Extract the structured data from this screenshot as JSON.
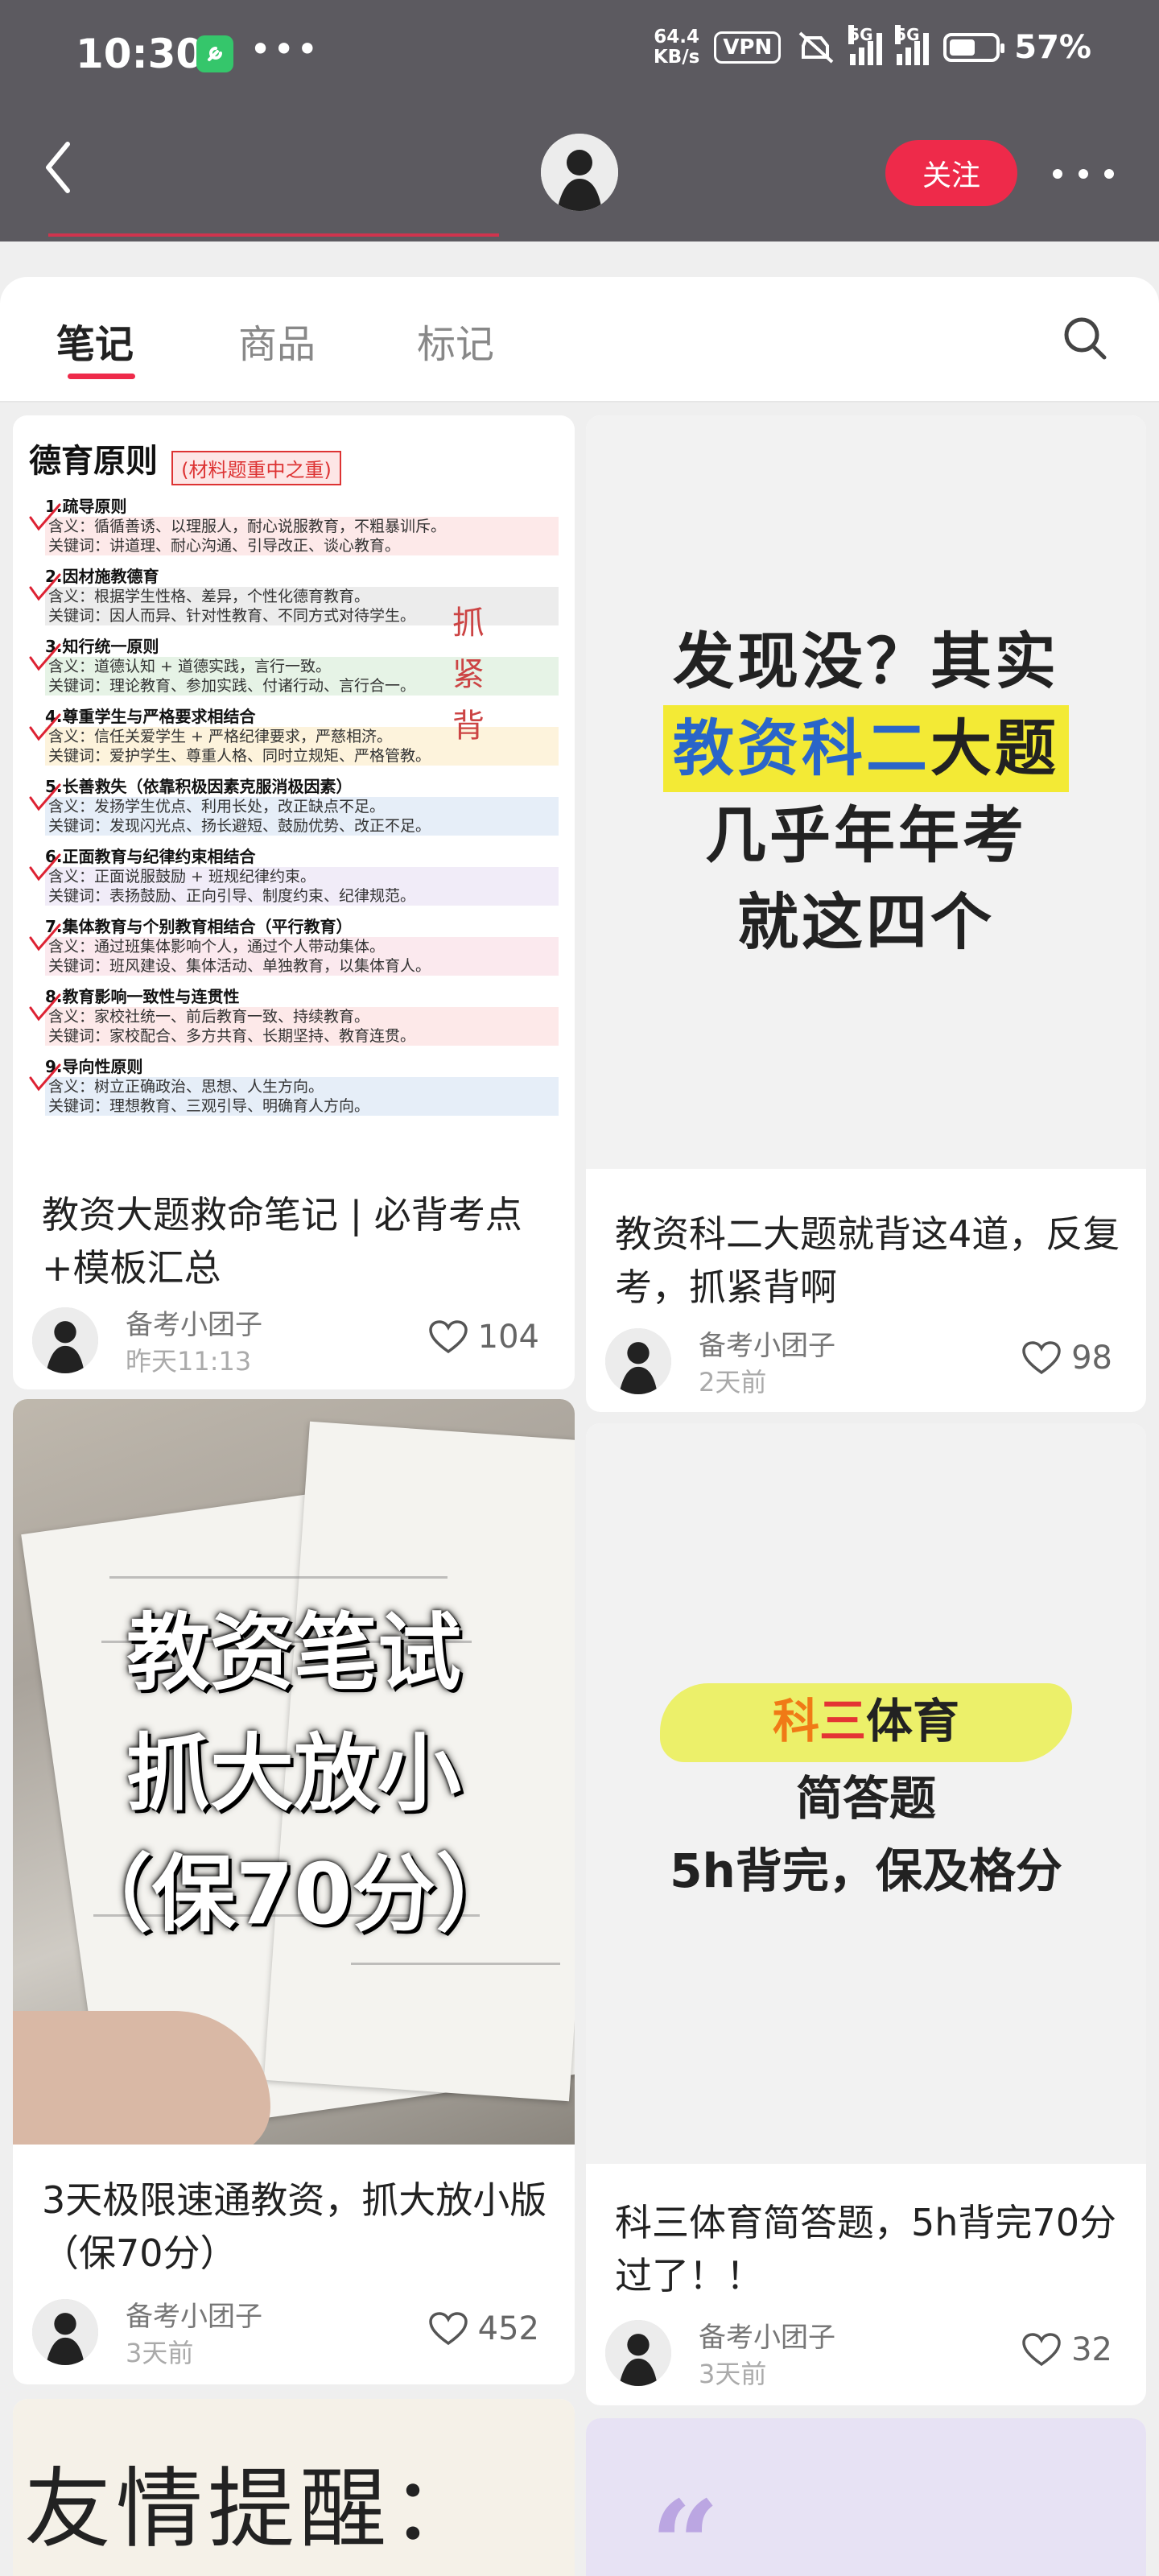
{
  "status_bar": {
    "time": "10:30",
    "net_speed_value": "64.4",
    "net_speed_unit": "KB/s",
    "vpn": "VPN",
    "sim1": "5G",
    "sim2": "5G",
    "battery": "57%",
    "battery_level": 0.57
  },
  "header": {
    "follow_label": "关注"
  },
  "tabs": [
    {
      "label": "笔记",
      "active": true
    },
    {
      "label": "商品",
      "active": false
    },
    {
      "label": "标记",
      "active": false
    }
  ],
  "notes": [
    {
      "title": "教资大题救命笔记 | 必背考点+模板汇总",
      "author": "备考小团子",
      "time": "昨天11:13",
      "likes": "104",
      "cover": {
        "heading": "德育原则",
        "tag": "(材料题重中之重)",
        "handwriting": "抓紧背",
        "principles": [
          {
            "title": "1.疏导原则",
            "l1": "含义：循循善诱、以理服人，耐心说服教育，不粗暴训斥。",
            "l2": "关键词：讲道理、耐心沟通、引导改正、谈心教育。"
          },
          {
            "title": "2.因材施教德育",
            "l1": "含义：根据学生性格、差异，个性化德育教育。",
            "l2": "关键词：因人而异、针对性教育、不同方式对待学生。"
          },
          {
            "title": "3.知行统一原则",
            "l1": "含义：道德认知 + 道德实践，言行一致。",
            "l2": "关键词：理论教育、参加实践、付诸行动、言行合一。"
          },
          {
            "title": "4.尊重学生与严格要求相结合",
            "l1": "含义：信任关爱学生 + 严格纪律要求，严慈相济。",
            "l2": "关键词：爱护学生、尊重人格、同时立规矩、严格管教。"
          },
          {
            "title": "5.长善救失（依靠积极因素克服消极因素）",
            "l1": "含义：发扬学生优点、利用长处，改正缺点不足。",
            "l2": "关键词：发现闪光点、扬长避短、鼓励优势、改正不足。"
          },
          {
            "title": "6.正面教育与纪律约束相结合",
            "l1": "含义：正面说服鼓励 + 班规纪律约束。",
            "l2": "关键词：表扬鼓励、正向引导、制度约束、纪律规范。"
          },
          {
            "title": "7.集体教育与个别教育相结合（平行教育）",
            "l1": "含义：通过班集体影响个人，通过个人带动集体。",
            "l2": "关键词：班风建设、集体活动、单独教育，以集体育人。"
          },
          {
            "title": "8.教育影响一致性与连贯性",
            "l1": "含义：家校社统一、前后教育一致、持续教育。",
            "l2": "关键词：家校配合、多方共育、长期坚持、教育连贯。"
          },
          {
            "title": "9.导向性原则",
            "l1": "含义：树立正确政治、思想、人生方向。",
            "l2": "关键词：理想教育、三观引导、明确育人方向。"
          }
        ]
      }
    },
    {
      "title": "教资科二大题就背这4道，反复考，抓紧背啊",
      "author": "备考小团子",
      "time": "2天前",
      "likes": "98",
      "cover": {
        "line1": "发现没？其实",
        "line2a": "教资科二",
        "line2b": "大题",
        "line3": "几乎年年考",
        "line4": "就这四个"
      }
    },
    {
      "title": "3天极限速通教资，抓大放小版（保70分）",
      "author": "备考小团子",
      "time": "3天前",
      "likes": "452",
      "cover": {
        "line1": "教资笔试",
        "line2": "抓大放小",
        "line3": "（保70分）"
      }
    },
    {
      "title": "科三体育简答题，5h背完70分过了！！",
      "author": "备考小团子",
      "time": "3天前",
      "likes": "32",
      "cover": {
        "line1a": "科",
        "line1b": "三",
        "line1c": "体育",
        "line2": "简答题",
        "line3": "5h背完，保及格分"
      }
    },
    {
      "cover": {
        "text": "友情提醒："
      }
    },
    {
      "cover": {
        "text": "“"
      }
    }
  ]
}
